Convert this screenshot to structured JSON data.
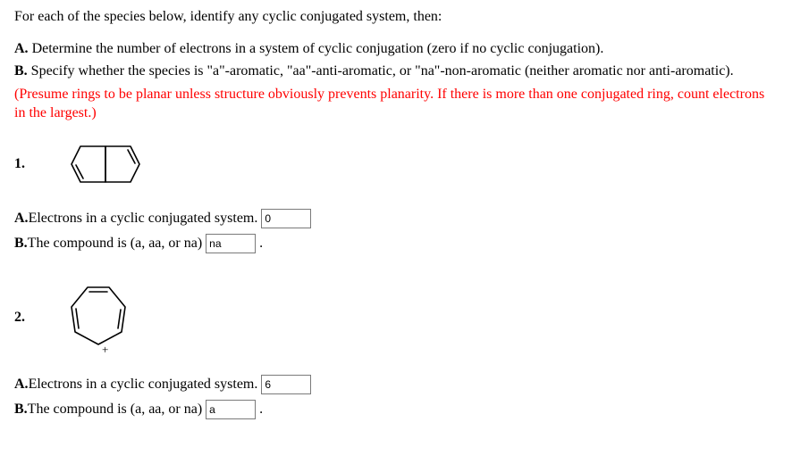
{
  "intro": "For each of the species below, identify any cyclic conjugated system, then:",
  "partA": "A. Determine the number of electrons in a system of cyclic conjugation (zero if no cyclic conjugation).",
  "partB": "B. Specify whether the species is \"a\"-aromatic, \"aa\"-anti-aromatic, or \"na\"-non-aromatic (neither aromatic nor anti-aromatic).",
  "hint": "(Presume rings to be planar unless structure obviously prevents planarity. If there is more than one conjugated ring, count electrons in the largest.)",
  "q1": {
    "num": "1.",
    "lineA_prefix": "A.",
    "lineA_text": "Electrons in a cyclic conjugated system.",
    "lineA_value": "0",
    "lineB_prefix": "B.",
    "lineB_text": "The compound is (a, aa, or na)",
    "lineB_value": "na",
    "period": "."
  },
  "q2": {
    "num": "2.",
    "lineA_prefix": "A.",
    "lineA_text": "Electrons in a cyclic conjugated system.",
    "lineA_value": "6",
    "lineB_prefix": "B.",
    "lineB_text": "The compound is (a, aa, or na)",
    "lineB_value": "a",
    "period": "."
  },
  "charge_plus": "+"
}
